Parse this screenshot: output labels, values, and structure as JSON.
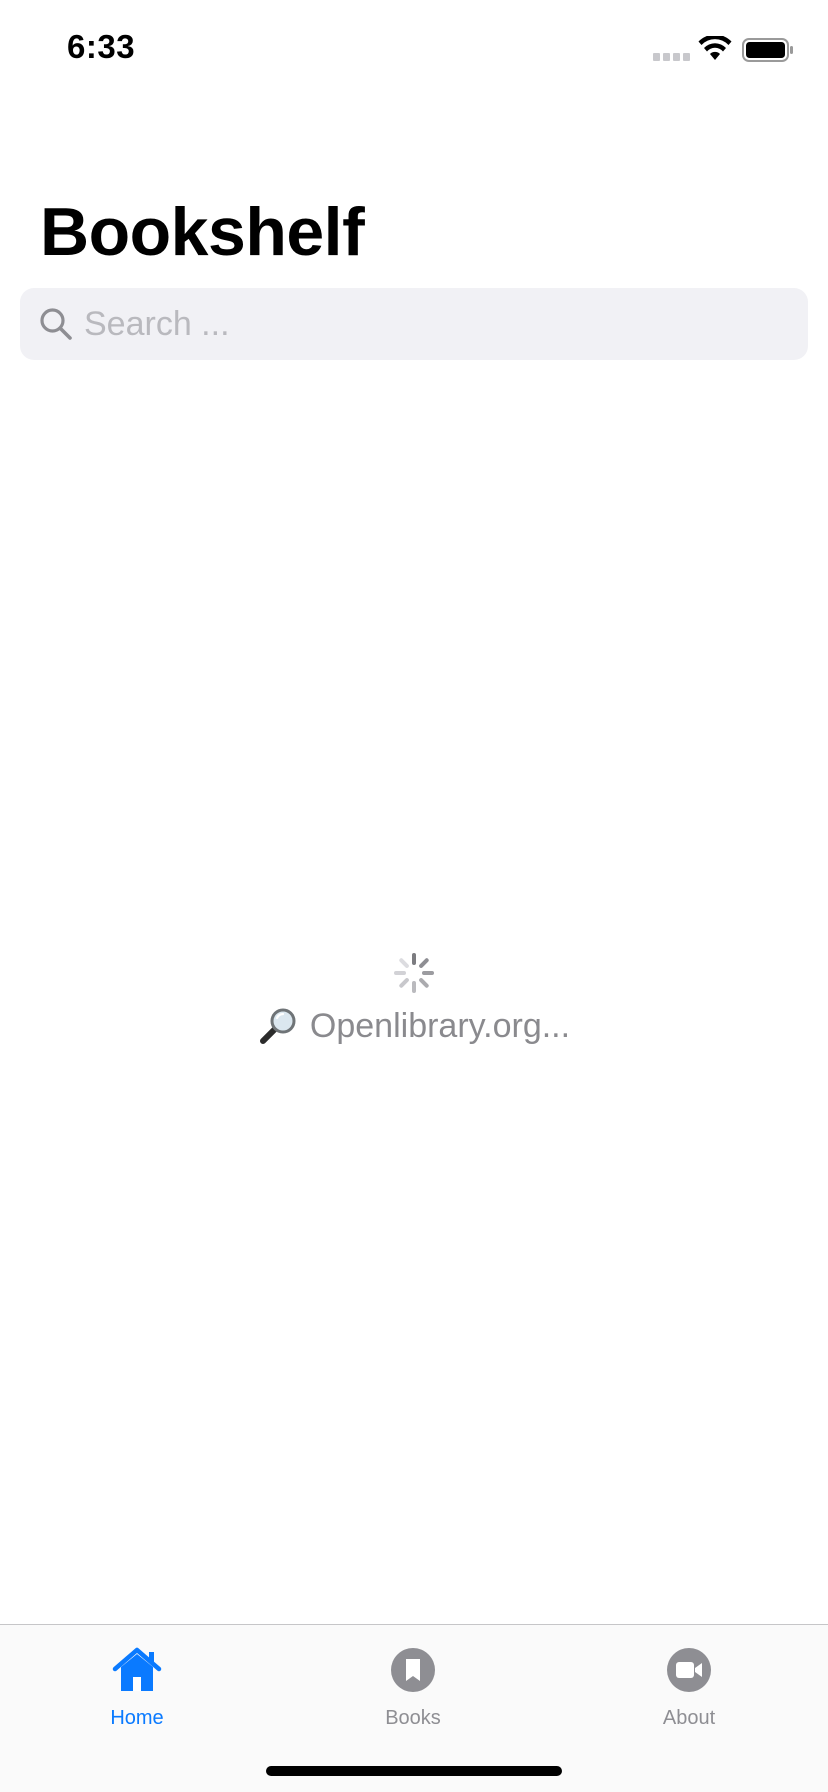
{
  "status_bar": {
    "time": "6:33"
  },
  "header": {
    "title": "Bookshelf"
  },
  "search": {
    "placeholder": "Search ...",
    "value": ""
  },
  "loading": {
    "icon": "magnifier-emoji",
    "text": "Openlibrary.org..."
  },
  "tab_bar": {
    "tabs": [
      {
        "label": "Home",
        "icon": "house-icon",
        "active": true
      },
      {
        "label": "Books",
        "icon": "bookmark-icon",
        "active": false
      },
      {
        "label": "About",
        "icon": "video-camera-icon",
        "active": false
      }
    ]
  },
  "colors": {
    "accent": "#0a7aff",
    "inactive": "#8e8e93",
    "search_bg": "#f1f1f5",
    "placeholder": "#b9b9be",
    "loading_text": "#8a8a8e"
  }
}
